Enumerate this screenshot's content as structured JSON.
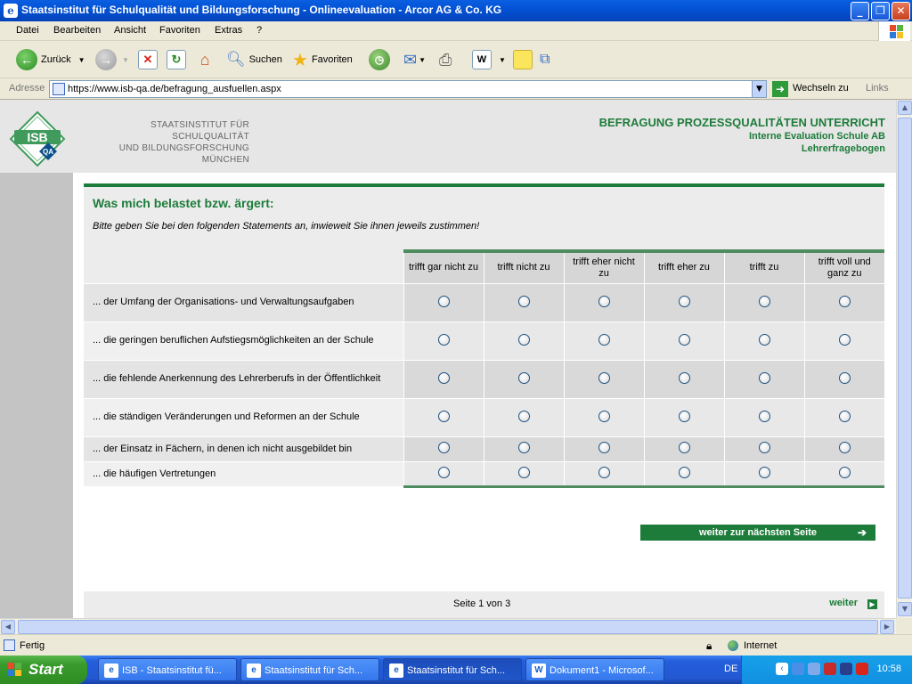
{
  "window": {
    "title": "Staatsinstitut für Schulqualität und Bildungsforschung - Onlineevaluation - Arcor AG & Co. KG",
    "minimize": "_",
    "maximize": "❐",
    "close": "✕"
  },
  "menu": [
    "Datei",
    "Bearbeiten",
    "Ansicht",
    "Favoriten",
    "Extras",
    "?"
  ],
  "toolbar": {
    "back_label": "Zurück",
    "search_label": "Suchen",
    "favorites_label": "Favoriten"
  },
  "address": {
    "label": "Adresse",
    "url": "https://www.isb-qa.de/befragung_ausfuellen.aspx",
    "go_label": "Wechseln zu",
    "links_label": "Links"
  },
  "header": {
    "logo_top": "ISB",
    "logo_bottom": "QA",
    "institute_lines": [
      "STAATSINSTITUT FÜR SCHULQUALITÄT",
      "UND BILDUNGSFORSCHUNG",
      "MÜNCHEN"
    ],
    "survey_title": "BEFRAGUNG PROZESSQUALITÄTEN UNTERRICHT",
    "survey_subtitle": "Interne Evaluation Schule AB",
    "survey_form": "Lehrerfragebogen"
  },
  "section": {
    "title": "Was mich belastet bzw. ärgert:",
    "instruction": "Bitte geben Sie bei den folgenden Statements an, inwieweit Sie ihnen jeweils zustimmen!",
    "scale": [
      "trifft gar nicht zu",
      "trifft nicht zu",
      "trifft eher nicht zu",
      "trifft eher zu",
      "trifft zu",
      "trifft voll und ganz zu"
    ],
    "statements": [
      "... der Umfang der Organisations- und Verwaltungsaufgaben",
      "... die geringen beruflichen Aufstiegsmöglichkeiten an der Schule",
      "... die fehlende Anerkennung des Lehrerberufs in der Öffentlichkeit",
      "... die ständigen Veränderungen und Reformen an der Schule",
      "... der Einsatz in Fächern, in denen ich nicht ausgebildet bin",
      "... die häufigen Vertretungen"
    ]
  },
  "navigation": {
    "next_button": "weiter zur nächsten Seite",
    "page_info": "Seite 1 von 3",
    "next_link": "weiter"
  },
  "status": {
    "text": "Fertig",
    "zone": "Internet"
  },
  "taskbar": {
    "start": "Start",
    "tasks": [
      "ISB - Staatsinstitut fü...",
      "Staatsinstitut für Sch...",
      "Staatsinstitut für Sch...",
      "Dokument1 - Microsof..."
    ],
    "active_task": 2,
    "language": "DE",
    "clock": "10:58"
  },
  "colors": {
    "brand_green": "#1d7c3a",
    "xp_blue": "#245edb"
  }
}
